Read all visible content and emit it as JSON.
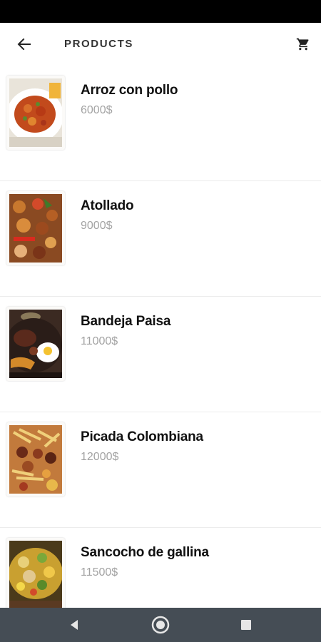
{
  "header": {
    "title": "PRODUCTS",
    "back_icon": "arrow-left-icon",
    "cart_icon": "shopping-cart-icon"
  },
  "products": [
    {
      "name": "Arroz con pollo",
      "price": "6000$"
    },
    {
      "name": "Atollado",
      "price": "9000$"
    },
    {
      "name": "Bandeja Paisa",
      "price": "11000$"
    },
    {
      "name": "Picada Colombiana",
      "price": "12000$"
    },
    {
      "name": "Sancocho de gallina",
      "price": "11500$"
    }
  ],
  "colors": {
    "status_bar": "#000000",
    "nav_bar": "#454d55",
    "price_text": "#a3a3a3",
    "name_text": "#111111"
  },
  "system_nav": {
    "back_icon": "triangle-back-icon",
    "home_icon": "circle-home-icon",
    "recents_icon": "square-recents-icon"
  }
}
